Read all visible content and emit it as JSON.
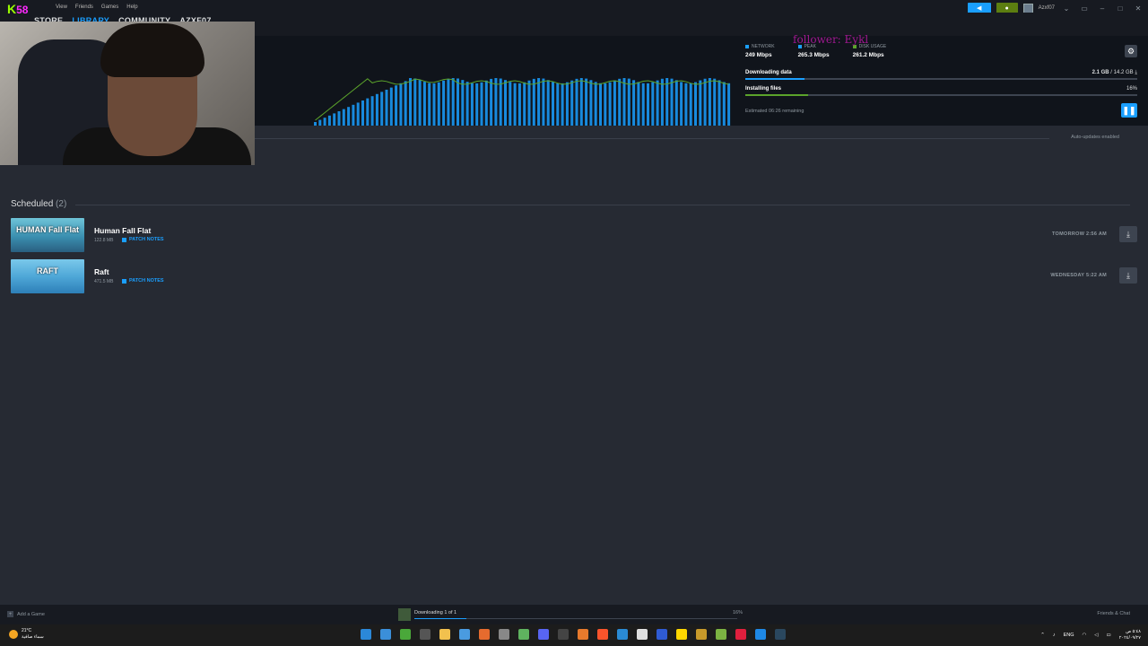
{
  "menu": {
    "items": [
      "View",
      "Friends",
      "Games",
      "Help"
    ]
  },
  "account": {
    "username": "Azxf07"
  },
  "nav": {
    "store": "STORE",
    "library": "LIBRARY",
    "community": "COMMUNITY",
    "profile": "AZXF07"
  },
  "overlay": {
    "badge_letter": "K",
    "badge_number": "58",
    "follower_text": "follower: Eykl"
  },
  "download": {
    "stats": [
      {
        "label": "NETWORK",
        "value": "249 Mbps",
        "color": "#1a9fff"
      },
      {
        "label": "PEAK",
        "value": "265.3 Mbps",
        "color": "#1a9fff"
      },
      {
        "label": "DISK USAGE",
        "value": "261.2 Mbps",
        "color": "#5ba32b"
      }
    ],
    "downloading_label": "Downloading data",
    "downloaded": "2.1 GB",
    "total": "14.2 GB",
    "downloading_progress": 0.15,
    "installing_label": "Installing files",
    "installing_percent": "16%",
    "installing_progress": 0.16,
    "eta": "Estimated 06:26 remaining",
    "auto_updates": "Auto-updates enabled",
    "bar_color": "#1a9fff",
    "disk_color": "#5ba32b"
  },
  "scheduled": {
    "title": "Scheduled",
    "count": "(2)",
    "games": [
      {
        "name": "Human Fall Flat",
        "size": "122.8 MB",
        "notes_label": "PATCH NOTES",
        "time": "TOMORROW 2:56 AM",
        "thumb_text": "HUMAN Fall Flat"
      },
      {
        "name": "Raft",
        "size": "471.5 MB",
        "notes_label": "PATCH NOTES",
        "time": "WEDNESDAY 5:22 AM",
        "thumb_text": "RAFT"
      }
    ]
  },
  "footer": {
    "add_game": "Add a Game",
    "downloading_status": "Downloading 1 of 1",
    "percent": "16%",
    "friends_chat": "Friends & Chat"
  },
  "taskbar": {
    "temperature": "21°C",
    "weather_desc": "سماء صافية",
    "language": "ENG",
    "time": "٥:٤٨ ص",
    "date": "٢٠٢٤/٠٩/٢٧"
  }
}
